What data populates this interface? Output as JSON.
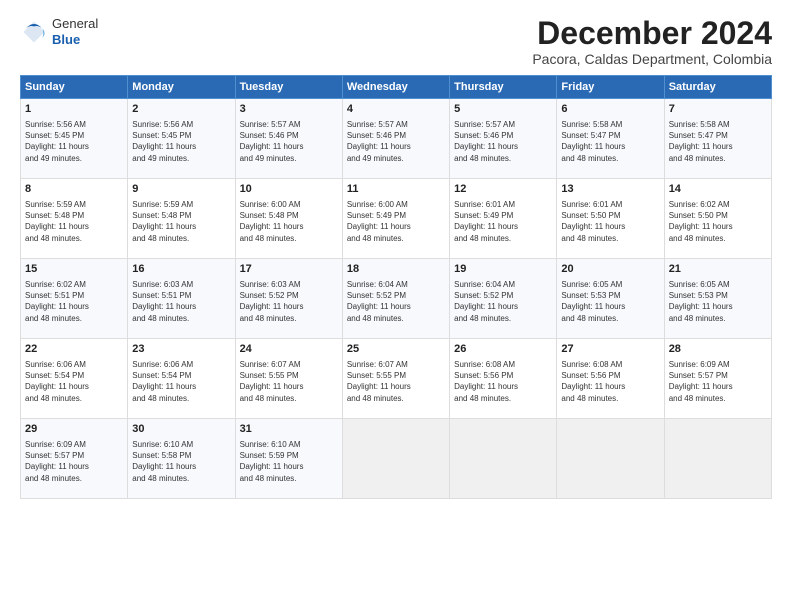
{
  "header": {
    "logo": {
      "line1": "General",
      "line2": "Blue"
    },
    "title": "December 2024",
    "subtitle": "Pacora, Caldas Department, Colombia"
  },
  "calendar": {
    "days_of_week": [
      "Sunday",
      "Monday",
      "Tuesday",
      "Wednesday",
      "Thursday",
      "Friday",
      "Saturday"
    ],
    "weeks": [
      [
        {
          "day": "",
          "info": ""
        },
        {
          "day": "2",
          "info": "Sunrise: 5:56 AM\nSunset: 5:45 PM\nDaylight: 11 hours\nand 49 minutes."
        },
        {
          "day": "3",
          "info": "Sunrise: 5:57 AM\nSunset: 5:46 PM\nDaylight: 11 hours\nand 49 minutes."
        },
        {
          "day": "4",
          "info": "Sunrise: 5:57 AM\nSunset: 5:46 PM\nDaylight: 11 hours\nand 49 minutes."
        },
        {
          "day": "5",
          "info": "Sunrise: 5:57 AM\nSunset: 5:46 PM\nDaylight: 11 hours\nand 48 minutes."
        },
        {
          "day": "6",
          "info": "Sunrise: 5:58 AM\nSunset: 5:47 PM\nDaylight: 11 hours\nand 48 minutes."
        },
        {
          "day": "7",
          "info": "Sunrise: 5:58 AM\nSunset: 5:47 PM\nDaylight: 11 hours\nand 48 minutes."
        }
      ],
      [
        {
          "day": "8",
          "info": "Sunrise: 5:59 AM\nSunset: 5:48 PM\nDaylight: 11 hours\nand 48 minutes."
        },
        {
          "day": "9",
          "info": "Sunrise: 5:59 AM\nSunset: 5:48 PM\nDaylight: 11 hours\nand 48 minutes."
        },
        {
          "day": "10",
          "info": "Sunrise: 6:00 AM\nSunset: 5:48 PM\nDaylight: 11 hours\nand 48 minutes."
        },
        {
          "day": "11",
          "info": "Sunrise: 6:00 AM\nSunset: 5:49 PM\nDaylight: 11 hours\nand 48 minutes."
        },
        {
          "day": "12",
          "info": "Sunrise: 6:01 AM\nSunset: 5:49 PM\nDaylight: 11 hours\nand 48 minutes."
        },
        {
          "day": "13",
          "info": "Sunrise: 6:01 AM\nSunset: 5:50 PM\nDaylight: 11 hours\nand 48 minutes."
        },
        {
          "day": "14",
          "info": "Sunrise: 6:02 AM\nSunset: 5:50 PM\nDaylight: 11 hours\nand 48 minutes."
        }
      ],
      [
        {
          "day": "15",
          "info": "Sunrise: 6:02 AM\nSunset: 5:51 PM\nDaylight: 11 hours\nand 48 minutes."
        },
        {
          "day": "16",
          "info": "Sunrise: 6:03 AM\nSunset: 5:51 PM\nDaylight: 11 hours\nand 48 minutes."
        },
        {
          "day": "17",
          "info": "Sunrise: 6:03 AM\nSunset: 5:52 PM\nDaylight: 11 hours\nand 48 minutes."
        },
        {
          "day": "18",
          "info": "Sunrise: 6:04 AM\nSunset: 5:52 PM\nDaylight: 11 hours\nand 48 minutes."
        },
        {
          "day": "19",
          "info": "Sunrise: 6:04 AM\nSunset: 5:52 PM\nDaylight: 11 hours\nand 48 minutes."
        },
        {
          "day": "20",
          "info": "Sunrise: 6:05 AM\nSunset: 5:53 PM\nDaylight: 11 hours\nand 48 minutes."
        },
        {
          "day": "21",
          "info": "Sunrise: 6:05 AM\nSunset: 5:53 PM\nDaylight: 11 hours\nand 48 minutes."
        }
      ],
      [
        {
          "day": "22",
          "info": "Sunrise: 6:06 AM\nSunset: 5:54 PM\nDaylight: 11 hours\nand 48 minutes."
        },
        {
          "day": "23",
          "info": "Sunrise: 6:06 AM\nSunset: 5:54 PM\nDaylight: 11 hours\nand 48 minutes."
        },
        {
          "day": "24",
          "info": "Sunrise: 6:07 AM\nSunset: 5:55 PM\nDaylight: 11 hours\nand 48 minutes."
        },
        {
          "day": "25",
          "info": "Sunrise: 6:07 AM\nSunset: 5:55 PM\nDaylight: 11 hours\nand 48 minutes."
        },
        {
          "day": "26",
          "info": "Sunrise: 6:08 AM\nSunset: 5:56 PM\nDaylight: 11 hours\nand 48 minutes."
        },
        {
          "day": "27",
          "info": "Sunrise: 6:08 AM\nSunset: 5:56 PM\nDaylight: 11 hours\nand 48 minutes."
        },
        {
          "day": "28",
          "info": "Sunrise: 6:09 AM\nSunset: 5:57 PM\nDaylight: 11 hours\nand 48 minutes."
        }
      ],
      [
        {
          "day": "29",
          "info": "Sunrise: 6:09 AM\nSunset: 5:57 PM\nDaylight: 11 hours\nand 48 minutes."
        },
        {
          "day": "30",
          "info": "Sunrise: 6:10 AM\nSunset: 5:58 PM\nDaylight: 11 hours\nand 48 minutes."
        },
        {
          "day": "31",
          "info": "Sunrise: 6:10 AM\nSunset: 5:59 PM\nDaylight: 11 hours\nand 48 minutes."
        },
        {
          "day": "",
          "info": ""
        },
        {
          "day": "",
          "info": ""
        },
        {
          "day": "",
          "info": ""
        },
        {
          "day": "",
          "info": ""
        }
      ]
    ],
    "week1_day1": {
      "day": "1",
      "info": "Sunrise: 5:56 AM\nSunset: 5:45 PM\nDaylight: 11 hours\nand 49 minutes."
    }
  }
}
